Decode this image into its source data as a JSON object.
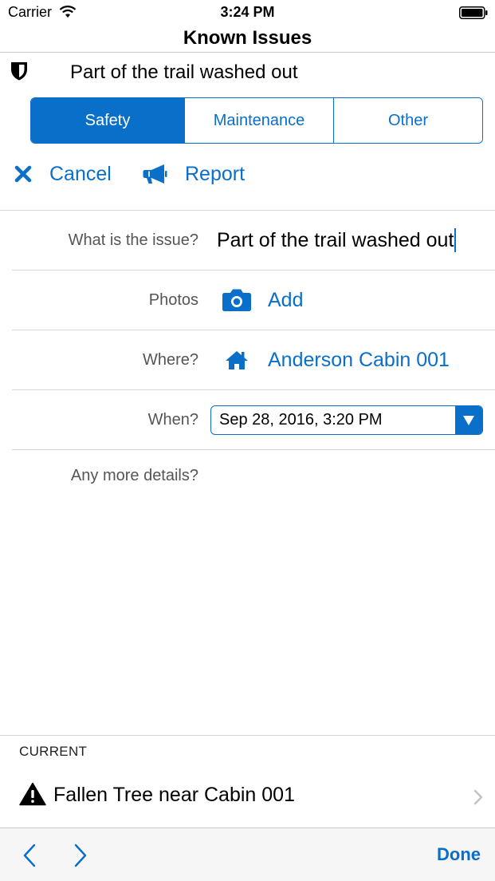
{
  "status_bar": {
    "carrier": "Carrier",
    "time": "3:24 PM"
  },
  "nav": {
    "title": "Known Issues"
  },
  "issue_header": {
    "title": "Part of the trail washed out"
  },
  "segments": [
    {
      "label": "Safety",
      "selected": true
    },
    {
      "label": "Maintenance",
      "selected": false
    },
    {
      "label": "Other",
      "selected": false
    }
  ],
  "actions": {
    "cancel_label": "Cancel",
    "report_label": "Report"
  },
  "form": {
    "issue_label": "What is the issue?",
    "issue_value": "Part of the trail washed out",
    "photos_label": "Photos",
    "photos_action": "Add",
    "where_label": "Where?",
    "where_value": "Anderson Cabin 001",
    "when_label": "When?",
    "when_value": "Sep 28, 2016, 3:20 PM",
    "details_label": "Any more details?"
  },
  "current": {
    "header": "CURRENT",
    "items": [
      {
        "label": "Fallen Tree near Cabin 001"
      }
    ]
  },
  "toolbar": {
    "done_label": "Done"
  },
  "colors": {
    "accent": "#0a6fc9",
    "text": "#000000",
    "label": "#555555"
  }
}
